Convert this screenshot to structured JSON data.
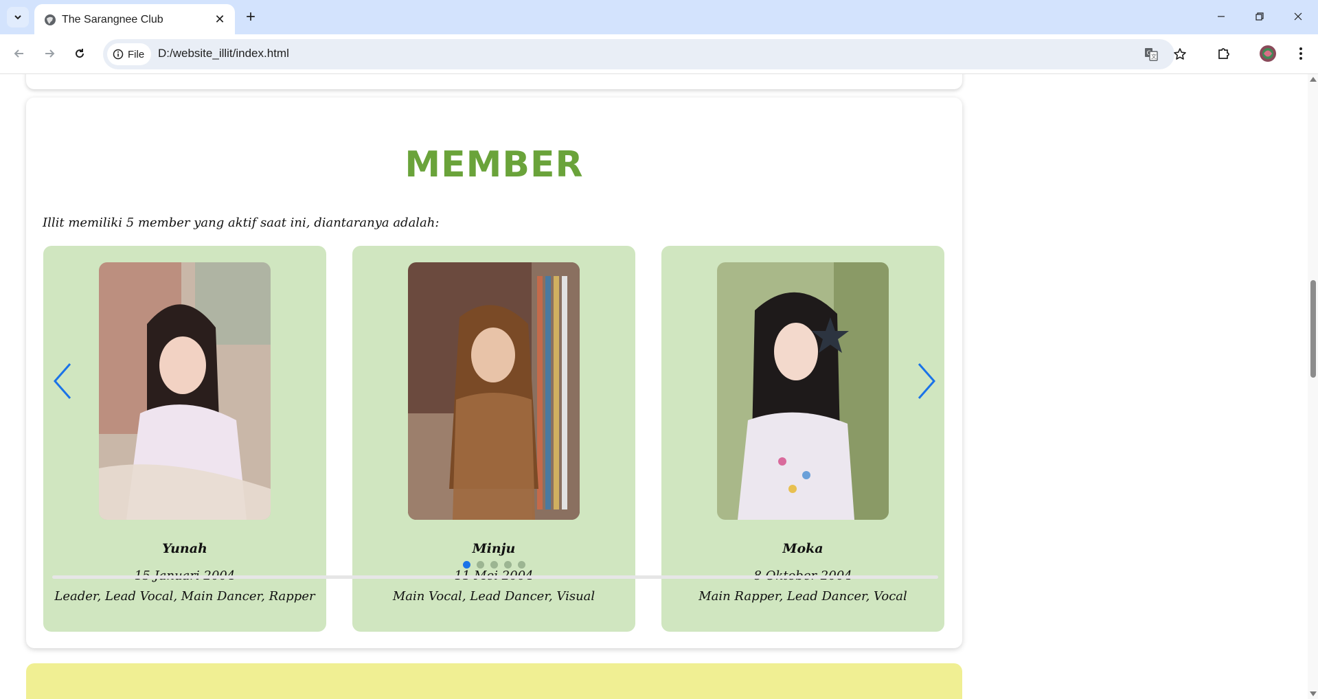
{
  "browser": {
    "tab_title": "The Sarangnee Club",
    "url_chip": "File",
    "url": "D:/website_illit/index.html",
    "new_tab": "+",
    "close_tab": "✕"
  },
  "member": {
    "title": "MEMBER",
    "intro": "Illit memiliki 5 member yang aktif saat ini, diantaranya adalah:",
    "cards": [
      {
        "name": "Yunah",
        "birth": "15 Januari 2004",
        "role": "Leader, Lead Vocal, Main Dancer, Rapper"
      },
      {
        "name": "Minju",
        "birth": "11 Mei 2004",
        "role": "Main Vocal, Lead Dancer, Visual"
      },
      {
        "name": "Moka",
        "birth": "8 Oktober 2004",
        "role": "Main Rapper, Lead Dancer, Vocal"
      }
    ],
    "pagination": {
      "total": 5,
      "active": 1
    }
  },
  "colors": {
    "accent": "#6aa33a",
    "card_bg": "#d0e6c0",
    "arrow": "#1a73e8",
    "next_section_bg": "#f0ef93"
  }
}
